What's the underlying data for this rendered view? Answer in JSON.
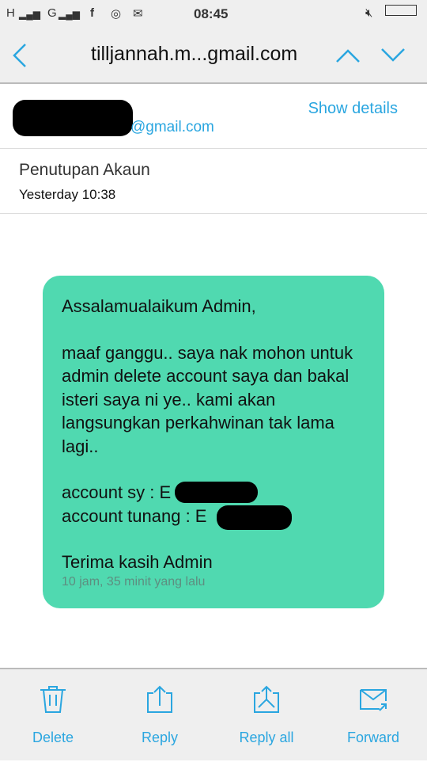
{
  "status_bar": {
    "network1": "H",
    "network2": "G",
    "time": "08:45"
  },
  "header": {
    "title": "tilljannah.m...gmail.com"
  },
  "sender": {
    "email_suffix": "@gmail.com",
    "show_details": "Show details"
  },
  "subject": {
    "title": "Penutupan Akaun",
    "date": "Yesterday 10:38"
  },
  "message": {
    "greeting": "Assalamualaikum Admin,",
    "body": "maaf ganggu.. saya nak mohon untuk admin delete account saya dan bakal isteri saya ni ye.. kami akan langsungkan perkahwinan tak lama lagi..",
    "account_sy": "account sy : E",
    "account_tunang": "account tunang : E",
    "closing": "Terima kasih Admin",
    "time_ago": "10 jam, 35 minit yang lalu",
    "bubble_color": "#50d9b0"
  },
  "actions": [
    {
      "label": "Delete",
      "icon": "trash-icon"
    },
    {
      "label": "Reply",
      "icon": "reply-icon"
    },
    {
      "label": "Reply all",
      "icon": "reply-all-icon"
    },
    {
      "label": "Forward",
      "icon": "forward-icon"
    }
  ],
  "accent": "#2aa6e0"
}
